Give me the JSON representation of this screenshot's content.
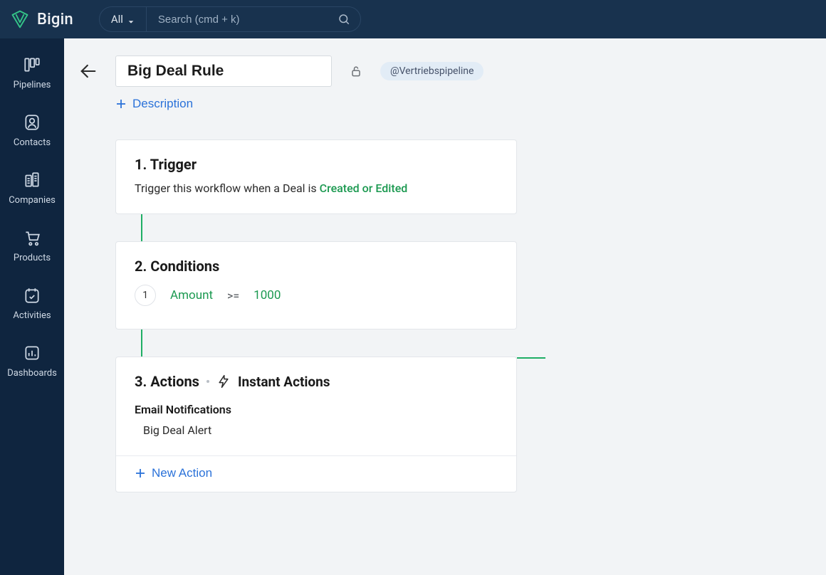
{
  "header": {
    "brand": "Bigin",
    "scope_label": "All",
    "search_placeholder": "Search (cmd + k)"
  },
  "sidebar": {
    "items": [
      {
        "label": "Pipelines"
      },
      {
        "label": "Contacts"
      },
      {
        "label": "Companies"
      },
      {
        "label": "Products"
      },
      {
        "label": "Activities"
      },
      {
        "label": "Dashboards"
      }
    ]
  },
  "rule": {
    "title": "Big Deal Rule",
    "mention": "@Vertriebspipeline",
    "description_button": "Description"
  },
  "trigger": {
    "heading": "1. Trigger",
    "pre_text": "Trigger this workflow when a Deal is ",
    "event": "Created or Edited"
  },
  "conditions": {
    "heading": "2. Conditions",
    "rows": [
      {
        "index": "1",
        "field": "Amount",
        "operator": ">=",
        "value": "1000"
      }
    ]
  },
  "actions": {
    "heading": "3. Actions",
    "instant_label": "Instant Actions",
    "groups": [
      {
        "title": "Email Notifications",
        "items": [
          "Big Deal Alert"
        ]
      }
    ],
    "new_action": "New Action"
  }
}
